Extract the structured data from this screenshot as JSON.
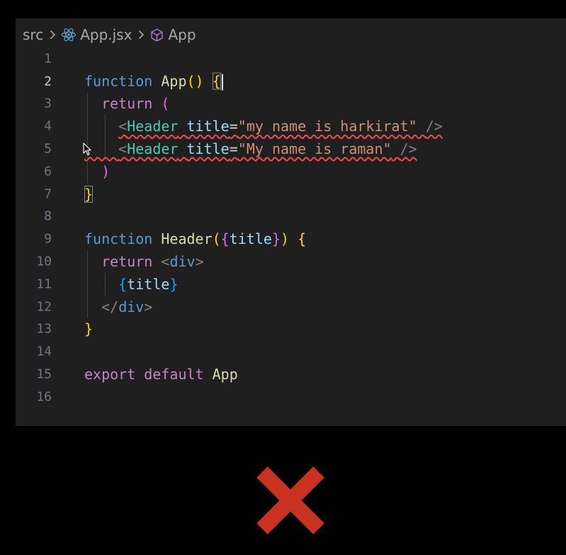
{
  "breadcrumb": {
    "folder": "src",
    "file": "App.jsx",
    "symbol": "App"
  },
  "editor": {
    "active_line": 2,
    "lines": [
      {
        "number": "1",
        "tokens": []
      },
      {
        "number": "2",
        "tokens": [
          {
            "text": "function",
            "kind": "kw"
          },
          {
            "text": " "
          },
          {
            "text": "App",
            "kind": "fn"
          },
          {
            "text": "()",
            "kind": "br1"
          },
          {
            "text": " "
          },
          {
            "text": "{",
            "kind": "br1",
            "match": true
          },
          {
            "text": "",
            "cursor": true
          }
        ]
      },
      {
        "number": "3",
        "tokens": [
          {
            "text": "  "
          },
          {
            "text": "return",
            "kind": "ctl"
          },
          {
            "text": " "
          },
          {
            "text": "(",
            "kind": "br2"
          }
        ]
      },
      {
        "number": "4",
        "tokens": [
          {
            "text": "    "
          },
          {
            "text": "<",
            "kind": "pun",
            "error": true
          },
          {
            "text": "Header",
            "kind": "tag",
            "error": true
          },
          {
            "text": " ",
            "error": true
          },
          {
            "text": "title",
            "kind": "attr",
            "error": true
          },
          {
            "text": "=",
            "kind": "plain",
            "error": true
          },
          {
            "text": "\"my name is harkirat\"",
            "kind": "str",
            "error": true
          },
          {
            "text": " ",
            "error": true
          },
          {
            "text": "/>",
            "kind": "pun",
            "error": true
          }
        ]
      },
      {
        "number": "5",
        "tokens": [
          {
            "text": "    ",
            "error": true
          },
          {
            "text": "<",
            "kind": "pun",
            "error": true
          },
          {
            "text": "Header",
            "kind": "tag",
            "error": true
          },
          {
            "text": " ",
            "error": true
          },
          {
            "text": "title",
            "kind": "attr",
            "error": true
          },
          {
            "text": "=",
            "kind": "plain",
            "error": true
          },
          {
            "text": "\"My name is raman\"",
            "kind": "str",
            "error": true
          },
          {
            "text": " ",
            "error": true
          },
          {
            "text": "/>",
            "kind": "pun",
            "error": true
          }
        ]
      },
      {
        "number": "6",
        "tokens": [
          {
            "text": "  "
          },
          {
            "text": ")",
            "kind": "br2"
          }
        ]
      },
      {
        "number": "7",
        "tokens": [
          {
            "text": "}",
            "kind": "br1",
            "match": true
          }
        ]
      },
      {
        "number": "8",
        "tokens": []
      },
      {
        "number": "9",
        "tokens": [
          {
            "text": "function",
            "kind": "kw"
          },
          {
            "text": " "
          },
          {
            "text": "Header",
            "kind": "fn"
          },
          {
            "text": "(",
            "kind": "br1"
          },
          {
            "text": "{",
            "kind": "br2"
          },
          {
            "text": "title",
            "kind": "var"
          },
          {
            "text": "}",
            "kind": "br2"
          },
          {
            "text": ")",
            "kind": "br1"
          },
          {
            "text": " "
          },
          {
            "text": "{",
            "kind": "br1"
          }
        ]
      },
      {
        "number": "10",
        "tokens": [
          {
            "text": "  "
          },
          {
            "text": "return",
            "kind": "ctl"
          },
          {
            "text": " "
          },
          {
            "text": "<",
            "kind": "pun"
          },
          {
            "text": "div",
            "kind": "kw"
          },
          {
            "text": ">",
            "kind": "pun"
          }
        ]
      },
      {
        "number": "11",
        "tokens": [
          {
            "text": "    "
          },
          {
            "text": "{",
            "kind": "br3"
          },
          {
            "text": "title",
            "kind": "var"
          },
          {
            "text": "}",
            "kind": "br3"
          }
        ]
      },
      {
        "number": "12",
        "tokens": [
          {
            "text": "  "
          },
          {
            "text": "</",
            "kind": "pun"
          },
          {
            "text": "div",
            "kind": "kw"
          },
          {
            "text": ">",
            "kind": "pun"
          }
        ]
      },
      {
        "number": "13",
        "tokens": [
          {
            "text": "}",
            "kind": "br1"
          }
        ]
      },
      {
        "number": "14",
        "tokens": []
      },
      {
        "number": "15",
        "tokens": [
          {
            "text": "export",
            "kind": "ctl"
          },
          {
            "text": " "
          },
          {
            "text": "default",
            "kind": "ctl"
          },
          {
            "text": " "
          },
          {
            "text": "App",
            "kind": "fn"
          }
        ]
      },
      {
        "number": "16",
        "tokens": []
      }
    ]
  },
  "icons": {
    "react": "react-icon",
    "symbol": "cube-icon",
    "chevron": "chevron-right-icon",
    "pointer": "mouse-pointer-icon",
    "error_mark": "red-x-icon"
  },
  "colors": {
    "editor_bg": "#1f1f1f",
    "page_bg": "#000000",
    "error_squiggle": "#f14c4c",
    "error_mark": "#c8321e"
  }
}
